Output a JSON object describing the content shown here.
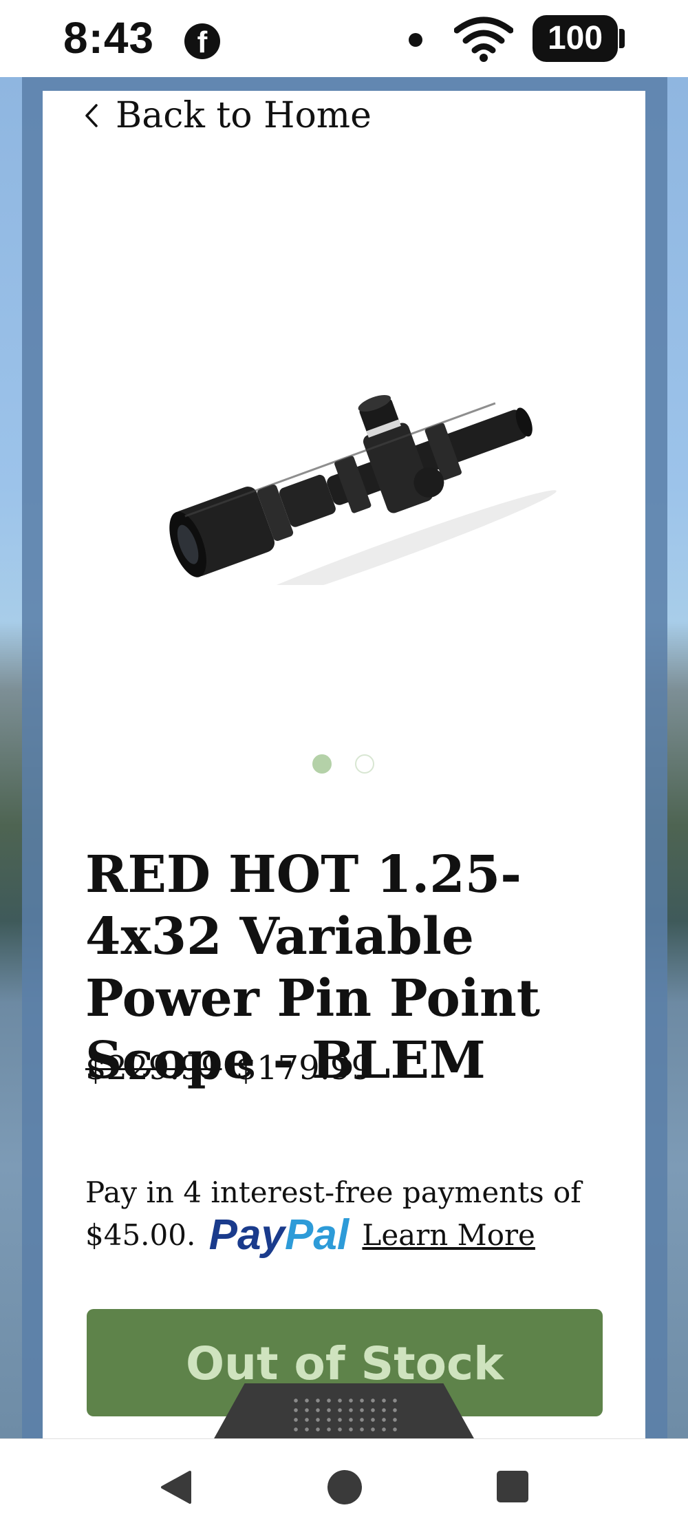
{
  "status_bar": {
    "time": "8:43",
    "battery": "100",
    "icons": [
      "facebook-icon",
      "notification-dot-icon",
      "wifi-icon",
      "battery-icon"
    ]
  },
  "nav": {
    "back_label": "Back to Home",
    "back_icon": "chevron-left-icon"
  },
  "product": {
    "image": "rifle-scope-image",
    "carousel": {
      "count": 2,
      "active_index": 0
    },
    "title": "RED HOT 1.25-4x32 Variable Power Pin Point Scope - BLEM",
    "old_price": "$229.99",
    "price": "$179.99"
  },
  "paypal": {
    "text": "Pay in 4 interest-free payments of $45.00.",
    "logo_pay": "Pay",
    "logo_pal": "Pal",
    "learn_more": "Learn More"
  },
  "stock_button": {
    "label": "Out of Stock"
  },
  "colors": {
    "button_green": "#5e834a",
    "dot_active": "#b4d1a8",
    "paypal_dark": "#1a3b8c",
    "paypal_light": "#2d9bd8"
  },
  "system_nav": {
    "icons": [
      "back-triangle-icon",
      "home-circle-icon",
      "recents-square-icon"
    ]
  }
}
